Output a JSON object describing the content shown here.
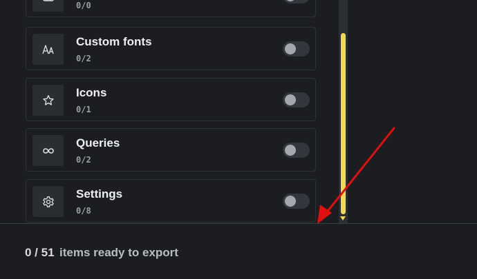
{
  "items": [
    {
      "title": "",
      "count": "0/0",
      "icon": "table-icon",
      "enabled": false
    },
    {
      "title": "Custom fonts",
      "count": "0/2",
      "icon": "font-icon",
      "enabled": false
    },
    {
      "title": "Icons",
      "count": "0/1",
      "icon": "star-icon",
      "enabled": false
    },
    {
      "title": "Queries",
      "count": "0/2",
      "icon": "infinity-icon",
      "enabled": false
    },
    {
      "title": "Settings",
      "count": "0/8",
      "icon": "gear-icon",
      "enabled": false
    }
  ],
  "footer": {
    "count": "0 / 51",
    "label": "items ready to export"
  },
  "colors": {
    "background": "#1b1d21",
    "scrollbar_thumb": "#f2d94f",
    "annotation_arrow": "#e01010"
  }
}
